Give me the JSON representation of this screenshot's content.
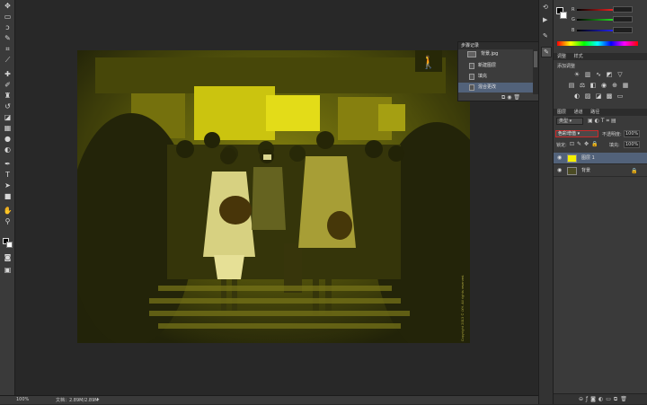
{
  "colors": {
    "workspace": "#282828",
    "panel": "#3a3a3a",
    "fill_yellow": "#f4f000",
    "highlight_red": "#cc2b2b"
  },
  "toolbar": {
    "tools": [
      "move-icon",
      "marquee-icon",
      "lasso-icon",
      "quick-select-icon",
      "crop-icon",
      "eyedropper-icon",
      "healing-icon",
      "brush-icon",
      "clone-stamp-icon",
      "history-brush-icon",
      "eraser-icon",
      "gradient-icon",
      "blur-icon",
      "dodge-icon",
      "pen-icon",
      "type-icon",
      "path-select-icon",
      "shape-icon",
      "hand-icon",
      "zoom-icon"
    ]
  },
  "statusbar": {
    "zoom": "100%",
    "doc_info": "文档：2.89M/2.89M"
  },
  "photo": {
    "watermark": "Copyright 2013 © LYH. All rights reserved."
  },
  "history": {
    "title": "步骤记录",
    "items": [
      {
        "label": "背景.jpg"
      },
      {
        "label": "新建图层"
      },
      {
        "label": "填充"
      },
      {
        "label": "混合更改"
      }
    ]
  },
  "color_panel": {
    "labels": [
      "R",
      "G",
      "B"
    ]
  },
  "adjustments": {
    "tabs": [
      "调整",
      "样式"
    ],
    "subtitle": "添加调整"
  },
  "layers": {
    "tabs": [
      "图层",
      "通道",
      "路径"
    ],
    "kind": "类型",
    "blend_mode": "色彩增值",
    "opacity_label": "不透明度:",
    "opacity_value": "100%",
    "lock_label": "锁定:",
    "fill_label": "填充:",
    "fill_value": "100%",
    "items": [
      {
        "name": "图层 1"
      },
      {
        "name": "背景"
      }
    ]
  }
}
